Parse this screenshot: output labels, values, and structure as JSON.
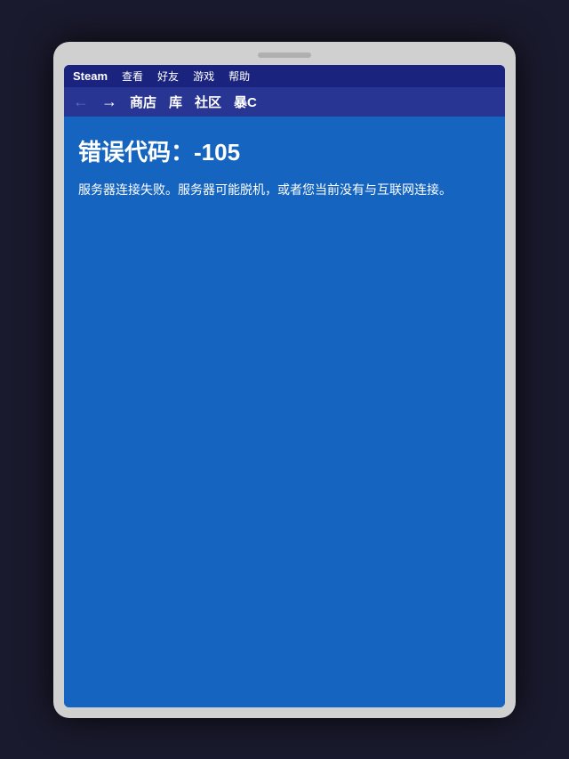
{
  "device": {
    "frame_color": "#d0d0d0"
  },
  "menu_bar": {
    "items": [
      {
        "id": "steam",
        "label": "Steam"
      },
      {
        "id": "view",
        "label": "查看"
      },
      {
        "id": "friends",
        "label": "好友"
      },
      {
        "id": "games",
        "label": "游戏"
      },
      {
        "id": "help",
        "label": "帮助"
      }
    ]
  },
  "nav_bar": {
    "back_arrow": "←",
    "forward_arrow": "→",
    "links": [
      {
        "id": "store",
        "label": "商店"
      },
      {
        "id": "library",
        "label": "库"
      },
      {
        "id": "community",
        "label": "社区"
      },
      {
        "id": "profile",
        "label": "暴C"
      }
    ]
  },
  "content": {
    "error_title": "错误代码：-105",
    "error_description": "服务器连接失败。服务器可能脱机，或者您当前没有与互联网连接。"
  }
}
